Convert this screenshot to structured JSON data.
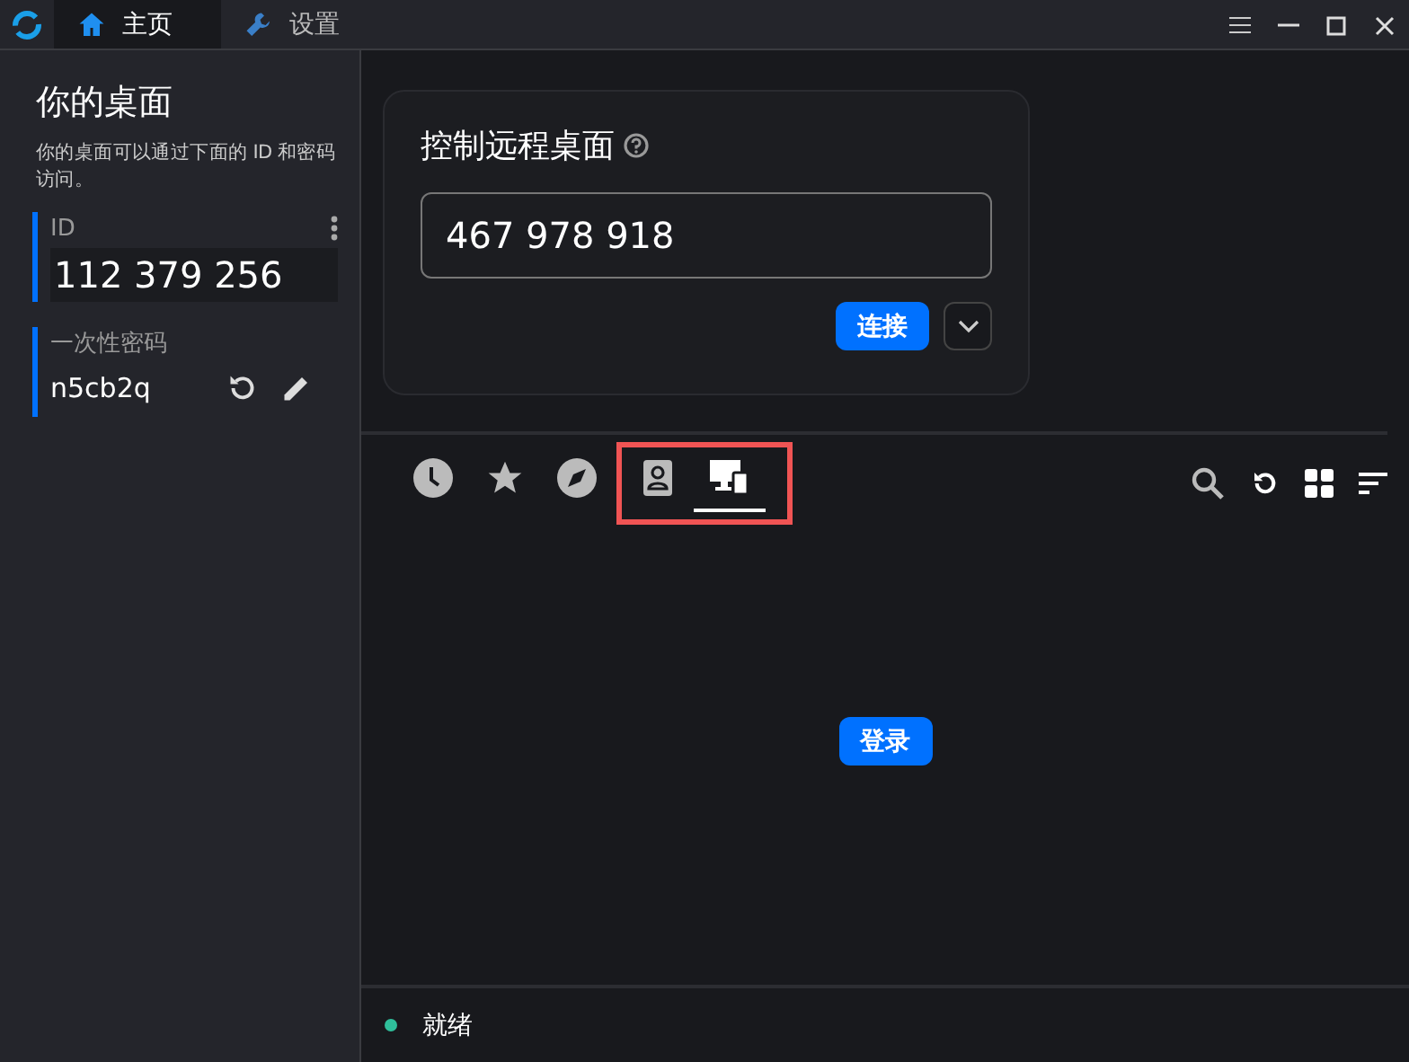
{
  "titlebar": {
    "tabs": [
      {
        "label": "主页",
        "selected": true
      },
      {
        "label": "设置",
        "selected": false
      }
    ]
  },
  "sidebar": {
    "title": "你的桌面",
    "description": "你的桌面可以通过下面的 ID 和密码访问。",
    "id_label": "ID",
    "id_value": "112 379 256",
    "password_label": "一次性密码",
    "password_value": "n5cb2q"
  },
  "connect_card": {
    "title": "控制远程桌面",
    "input_value": "467 978 918",
    "connect_button": "连接"
  },
  "peer_tabs": [
    {
      "selected": false,
      "highlighted": false
    },
    {
      "selected": false,
      "highlighted": false
    },
    {
      "selected": false,
      "highlighted": false
    },
    {
      "selected": false,
      "highlighted": true
    },
    {
      "selected": true,
      "highlighted": true
    }
  ],
  "login_button": "登录",
  "status_bar": {
    "text": "就绪",
    "color": "#2fbf9b"
  }
}
